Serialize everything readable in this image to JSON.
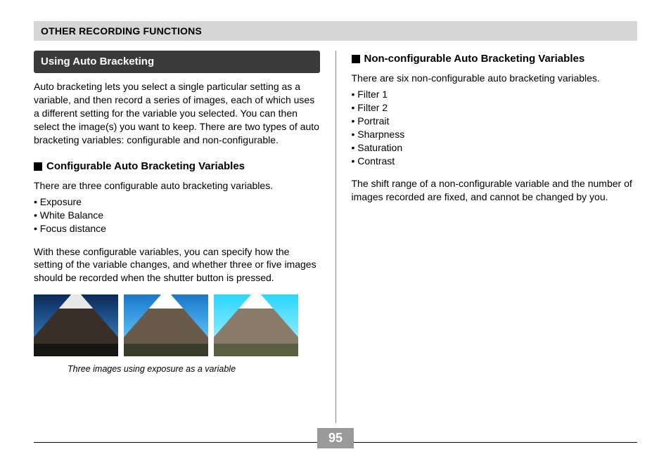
{
  "header": "OTHER RECORDING FUNCTIONS",
  "left": {
    "topic": "Using Auto Bracketing",
    "intro": "Auto bracketing lets you select a single particular setting as a variable, and then record a series of images, each of which uses a different setting for the variable you selected. You can then select the image(s) you want to keep. There are two types of auto bracketing variables: configurable and non-configurable.",
    "sub1_title": "Configurable Auto Bracketing Variables",
    "sub1_lead": "There are three configurable auto bracketing variables.",
    "sub1_items": [
      "• Exposure",
      "• White Balance",
      "• Focus distance"
    ],
    "sub1_after": "With these configurable variables, you can specify how the setting of the variable changes, and whether three or five images should be recorded when the shutter button is pressed.",
    "caption": "Three images using exposure as a variable"
  },
  "right": {
    "sub2_title": "Non-configurable Auto Bracketing Variables",
    "sub2_lead": "There are six non-configurable auto bracketing variables.",
    "sub2_items": [
      "• Filter 1",
      "• Filter 2",
      "• Portrait",
      "• Sharpness",
      "• Saturation",
      "• Contrast"
    ],
    "sub2_after": "The shift range of a non-configurable variable and the number of images recorded are fixed, and cannot be changed by you."
  },
  "page_number": "95"
}
